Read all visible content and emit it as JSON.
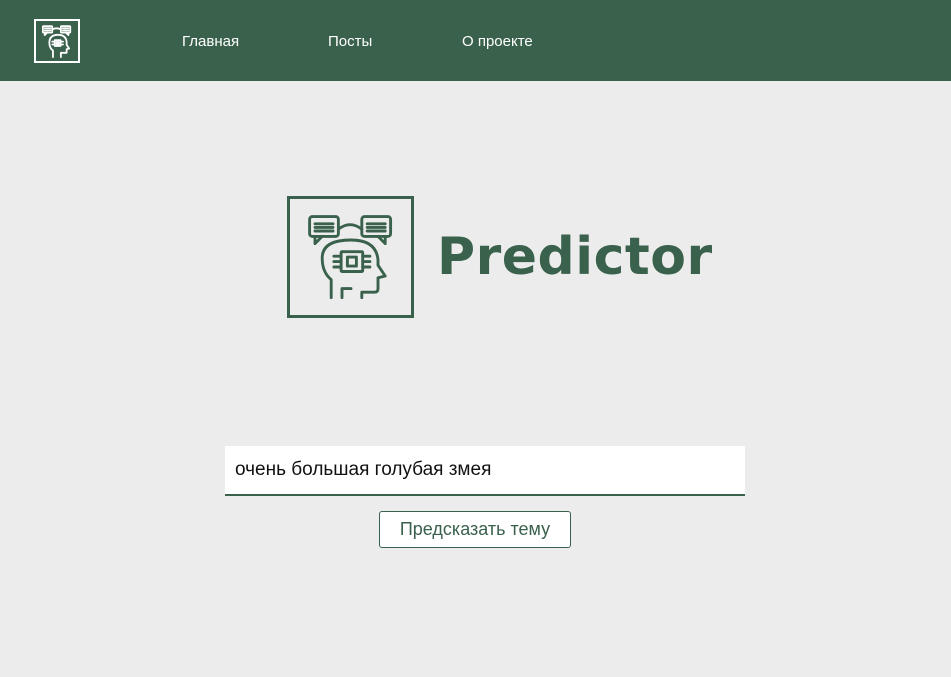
{
  "navbar": {
    "logo_icon": "ai-head-chat-icon",
    "links": [
      {
        "label": "Главная"
      },
      {
        "label": "Посты"
      },
      {
        "label": "О проекте"
      }
    ]
  },
  "hero": {
    "icon": "ai-head-chip-icon",
    "brand_name": "Predictor"
  },
  "form": {
    "input_value": "очень большая голубая змея",
    "submit_label": "Предсказать тему"
  },
  "colors": {
    "primary": "#3a614c",
    "background": "#ececec",
    "surface": "#ffffff"
  }
}
